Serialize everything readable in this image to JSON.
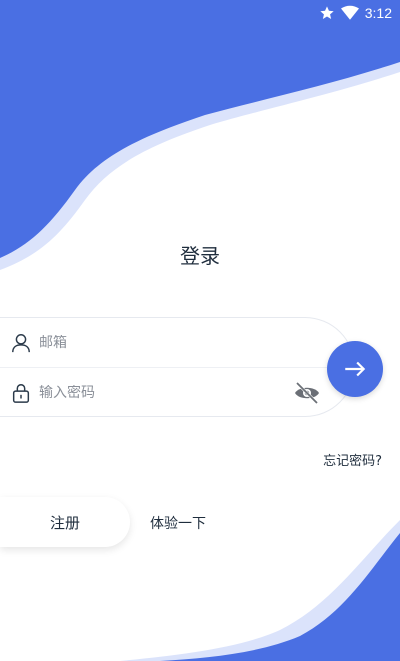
{
  "status_bar": {
    "time": "3:12",
    "icons": [
      "star-icon",
      "wifi-icon"
    ]
  },
  "login": {
    "title": "登录",
    "email_placeholder": "邮箱",
    "password_placeholder": "输入密码",
    "forgot_password": "忘记密码?",
    "register": "注册",
    "try_it": "体验一下"
  },
  "colors": {
    "accent": "#4a6fe3",
    "accent_light": "#dbe3fb",
    "text": "#1f2d3d"
  }
}
